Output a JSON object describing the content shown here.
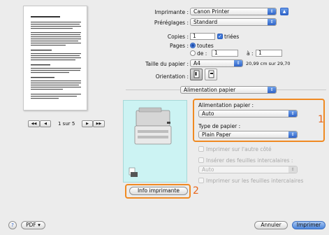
{
  "preview": {
    "page_title_line": "Exemple de document à imprimer",
    "nav_first": "◀◀",
    "nav_prev": "◀",
    "page_indicator": "1 sur 5",
    "nav_next": "▶",
    "nav_last": "▶▶"
  },
  "form": {
    "printer_label": "Imprimante :",
    "printer_value": "Canon Printer",
    "presets_label": "Préréglages :",
    "presets_value": "Standard",
    "copies_label": "Copies :",
    "copies_value": "1",
    "collated_label": "triées",
    "pages_label": "Pages :",
    "pages_all": "toutes",
    "pages_from": "de :",
    "pages_from_value": "1",
    "pages_to": "à :",
    "pages_to_value": "1",
    "paper_size_label": "Taille du papier :",
    "paper_size_value": "A4",
    "paper_size_dims": "20,99 cm sur 29,70",
    "orientation_label": "Orientation :",
    "section_value": "Alimentation papier"
  },
  "panel": {
    "source_label": "Alimentation papier :",
    "source_value": "Auto",
    "type_label": "Type de papier :",
    "type_value": "Plain Paper",
    "duplex_label": "Imprimer sur l'autre côté",
    "separator_label": "Insérer des feuilles intercalaires :",
    "separator_value": "Auto",
    "print_on_separator_label": "Imprimer sur les feuilles intercalaires",
    "info_button": "Info imprimante",
    "callout_1": "1",
    "callout_2": "2"
  },
  "footer": {
    "help": "?",
    "pdf": "PDF ▾",
    "cancel": "Annuler",
    "print": "Imprimer"
  },
  "colors": {
    "accent": "#3a74d8",
    "callout": "#f08a22",
    "preview_bg": "#ccf3f3"
  }
}
